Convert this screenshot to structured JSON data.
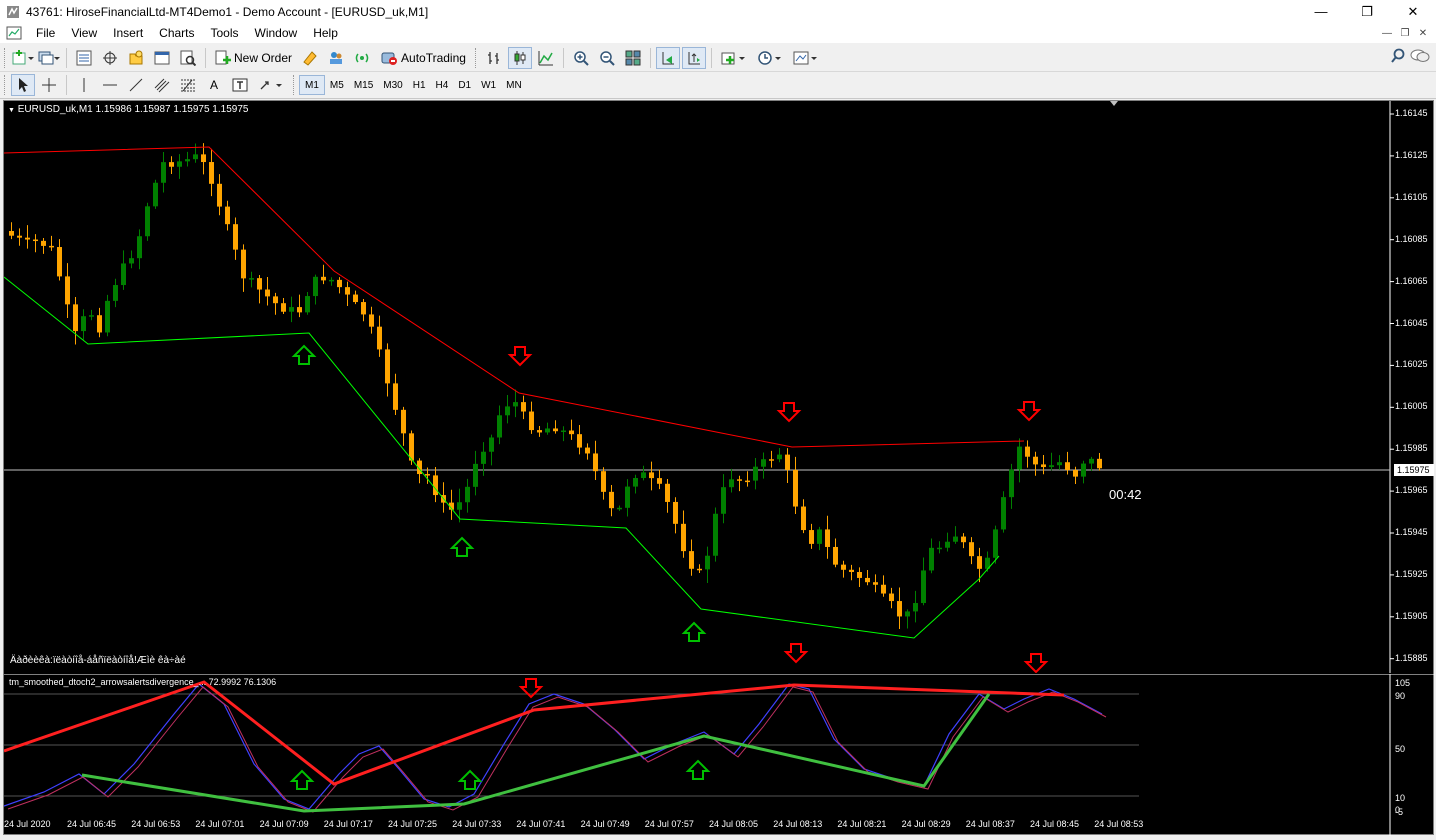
{
  "window": {
    "title": "43761: HiroseFinancialLtd-MT4Demo1 - Demo Account - [EURUSD_uk,M1]",
    "minimize": "—",
    "maximize": "❐",
    "close": "✕"
  },
  "menu": {
    "items": [
      "File",
      "View",
      "Insert",
      "Charts",
      "Tools",
      "Window",
      "Help"
    ]
  },
  "toolbar": {
    "new_order": "New Order",
    "autotrading": "AutoTrading"
  },
  "timeframes": [
    "M1",
    "M5",
    "M15",
    "M30",
    "H1",
    "H4",
    "D1",
    "W1",
    "MN"
  ],
  "chart": {
    "symbol_info": "EURUSD_uk,M1  1.15986 1.15987 1.15975 1.15975",
    "bottom_comment": "Äàðèèêà:ïëàòíîå-áåñïëàòíîå!Æìè êà÷àé",
    "countdown": "00:42",
    "current_price": "1.15975",
    "indicator_label": "tm_smoothed_dtoch2_arrowsalertsdivergence_... 72.9992 76.1306",
    "colors": {
      "bull_candle": "#008000",
      "bear_candle": "#ffa500",
      "upper_line": "#ff0000",
      "lower_line": "#00ff00",
      "arrow_down": "#ff0000",
      "arrow_up": "#00c000"
    }
  },
  "chart_data": {
    "type": "line",
    "title": "EURUSD_uk,M1",
    "price_axis": [
      "1.16145",
      "1.16125",
      "1.16105",
      "1.16085",
      "1.16065",
      "1.16045",
      "1.16025",
      "1.16005",
      "1.15985",
      "1.15965",
      "1.15945",
      "1.15925",
      "1.15905",
      "1.15885"
    ],
    "indicator_axis": [
      "105",
      "90",
      "50",
      "10",
      "0",
      "-5"
    ],
    "time_axis": [
      "24 Jul 2020",
      "24 Jul 06:45",
      "24 Jul 06:53",
      "24 Jul 07:01",
      "24 Jul 07:09",
      "24 Jul 07:17",
      "24 Jul 07:25",
      "24 Jul 07:33",
      "24 Jul 07:41",
      "24 Jul 07:49",
      "24 Jul 07:57",
      "24 Jul 08:05",
      "24 Jul 08:13",
      "24 Jul 08:21",
      "24 Jul 08:29",
      "24 Jul 08:37",
      "24 Jul 08:45",
      "24 Jul 08:53"
    ],
    "ylim": [
      1.15885,
      1.16145
    ],
    "indicator_ylim": [
      -5,
      105
    ]
  }
}
